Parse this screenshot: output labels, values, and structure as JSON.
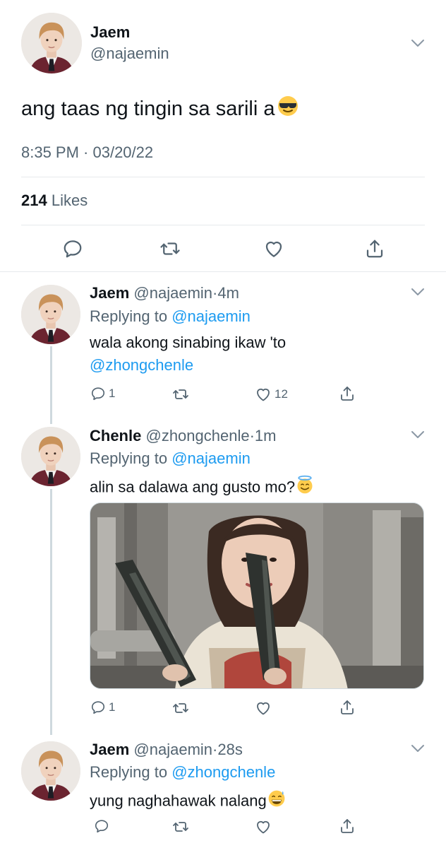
{
  "main_tweet": {
    "name": "Jaem",
    "handle": "@najaemin",
    "text": "ang taas ng tingin sa sarili a",
    "emoji": "sunglasses-emoji",
    "timestamp": "8:35 PM · 03/20/22",
    "likes_count": "214",
    "likes_label": "Likes",
    "actions": [
      "reply-icon",
      "retweet-icon",
      "like-icon",
      "share-icon"
    ]
  },
  "replies": [
    {
      "name": "Jaem",
      "handle": "@najaemin",
      "separator": "·",
      "time": "4m",
      "replying_prefix": "Replying to",
      "replying_to": "@najaemin",
      "text": "wala akong sinabing ikaw 'to",
      "mention": "@zhongchenle",
      "reply_count": "1",
      "like_count": "12"
    },
    {
      "name": "Chenle",
      "handle": "@zhongchenle",
      "separator": "·",
      "time": "1m",
      "replying_prefix": "Replying to",
      "replying_to": "@najaemin",
      "text": "alin sa dalawa ang gusto mo?",
      "emoji": "halo-smile-emoji",
      "media": "photo-woman-holding-knives",
      "reply_count": "1",
      "like_count": ""
    },
    {
      "name": "Jaem",
      "handle": "@najaemin",
      "separator": "·",
      "time": "28s",
      "replying_prefix": "Replying to",
      "replying_to": "@zhongchenle",
      "text": "yung naghahawak nalang",
      "emoji": "sweat-smile-emoji",
      "reply_count": "",
      "like_count": ""
    }
  ],
  "colors": {
    "link": "#1d9bf0",
    "secondary_text": "#536471",
    "divider": "#e6e9ec",
    "thread_line": "#cfd9de"
  }
}
